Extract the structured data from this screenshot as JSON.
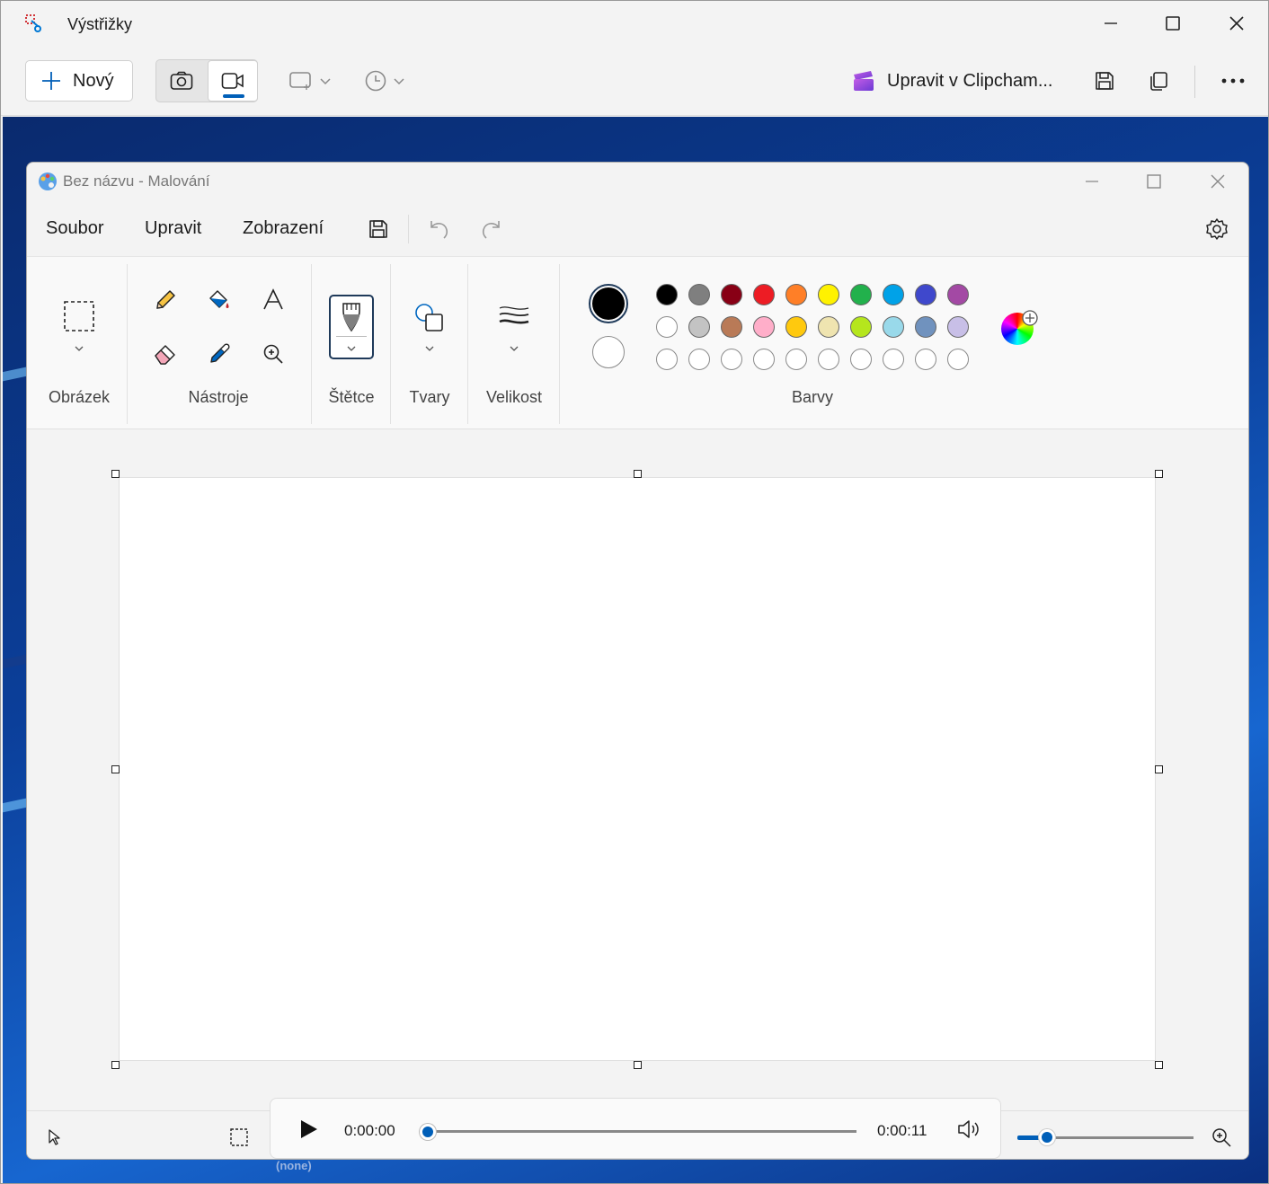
{
  "snip": {
    "title": "Výstřižky",
    "new_label": "Nový",
    "clipchamp_label": "Upravit v Clipcham..."
  },
  "paint": {
    "title": "Bez názvu - Malování",
    "menu": {
      "file": "Soubor",
      "edit": "Upravit",
      "view": "Zobrazení"
    },
    "ribbon": {
      "image": "Obrázek",
      "tools": "Nástroje",
      "brushes": "Štětce",
      "shapes": "Tvary",
      "size": "Velikost",
      "colors": "Barvy"
    },
    "palette_row1": [
      "#000000",
      "#7f7f7f",
      "#880015",
      "#ed1c24",
      "#ff7f27",
      "#fff200",
      "#22b14c",
      "#00a2e8",
      "#3f48cc",
      "#a349a4"
    ],
    "palette_row2": [
      "#ffffff",
      "#c3c3c3",
      "#b97a57",
      "#ffaec9",
      "#ffc90e",
      "#efe4b0",
      "#b5e61d",
      "#99d9ea",
      "#7092be",
      "#c8bfe7"
    ],
    "palette_row3": [
      "#ffffff",
      "#ffffff",
      "#ffffff",
      "#ffffff",
      "#ffffff",
      "#ffffff",
      "#ffffff",
      "#ffffff",
      "#ffffff",
      "#ffffff"
    ]
  },
  "player": {
    "current_time": "0:00:00",
    "total_time": "0:00:11",
    "progress_fraction": 0.0
  },
  "overlay_label": "(none)"
}
